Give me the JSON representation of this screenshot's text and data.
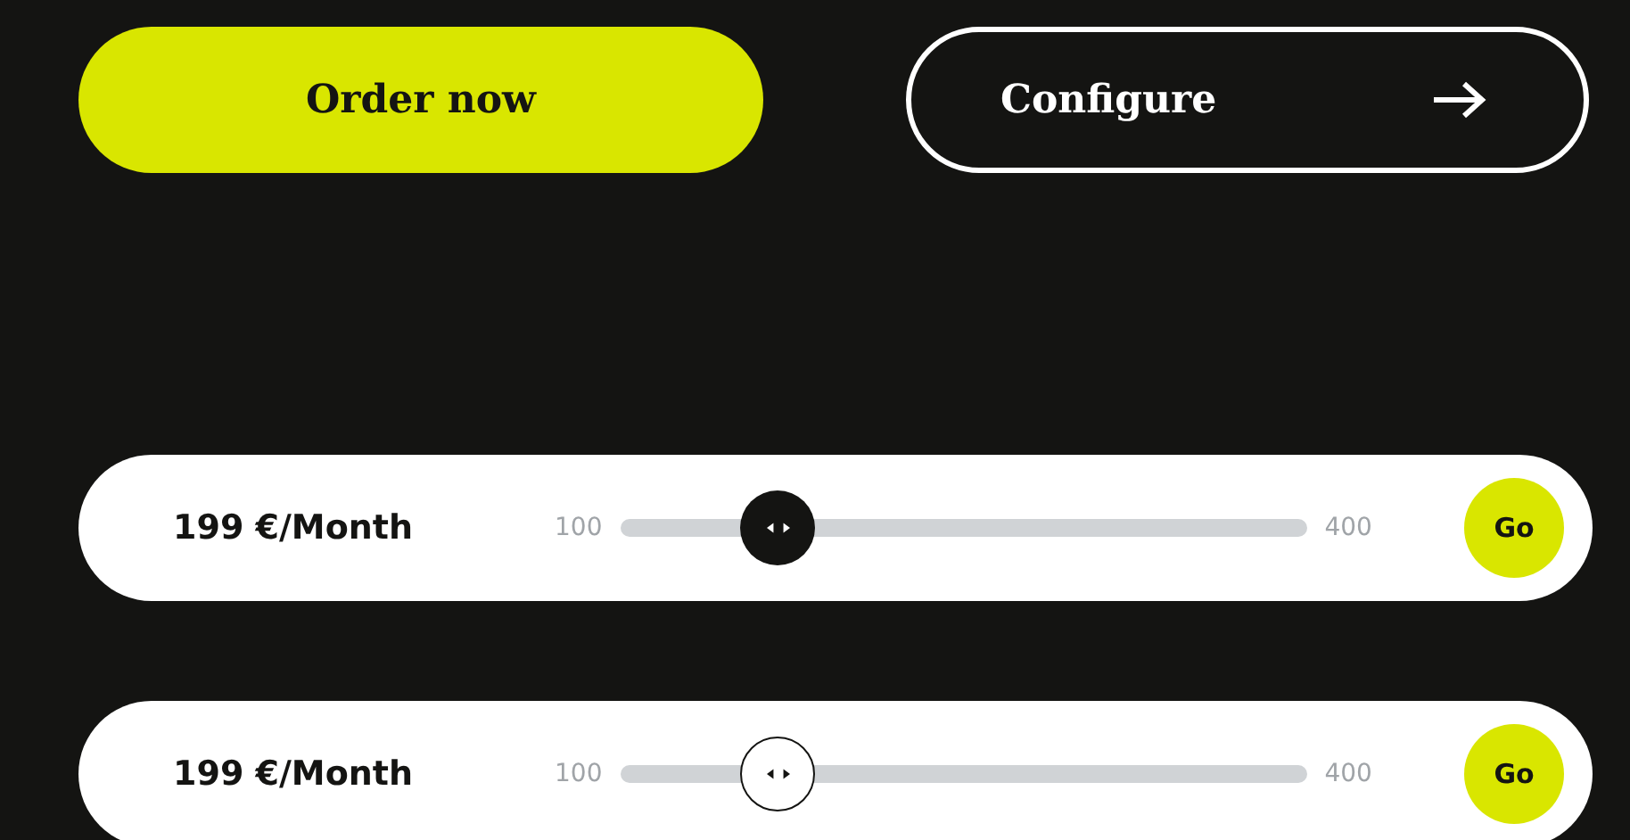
{
  "buttons": [
    {
      "label": "Order now",
      "kind": "primary"
    },
    {
      "label": "Configure",
      "kind": "outline"
    }
  ],
  "price_sliders": [
    {
      "price": "199 €/Month",
      "min_label": "100",
      "max_label": "400",
      "level": 0.23,
      "kind": "filled",
      "button": "Go"
    },
    {
      "price": "199 €/Month",
      "min_label": "100",
      "max_label": "400",
      "level": 0.23,
      "kind": "outline",
      "button": "Go"
    }
  ]
}
